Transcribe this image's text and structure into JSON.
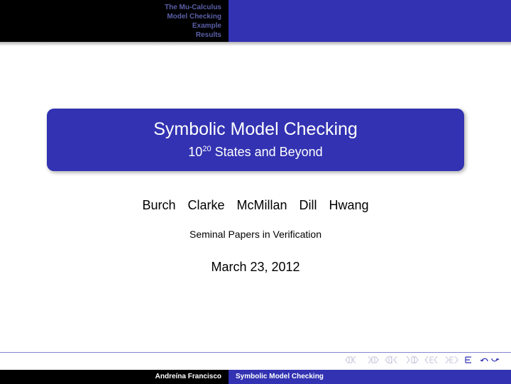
{
  "header": {
    "sections": [
      "The Mu-Calculus",
      "Model Checking",
      "Example",
      "Results"
    ]
  },
  "titleBlock": {
    "title": "Symbolic Model Checking",
    "subtitle_prefix": "10",
    "subtitle_exp": "20",
    "subtitle_suffix": " States and Beyond"
  },
  "authors": "Burch Clarke McMillan Dill Hwang",
  "institute": "Seminal Papers in Verification",
  "date": "March 23, 2012",
  "footer": {
    "author": "Andreína Francisco",
    "title": "Symbolic Model Checking"
  }
}
